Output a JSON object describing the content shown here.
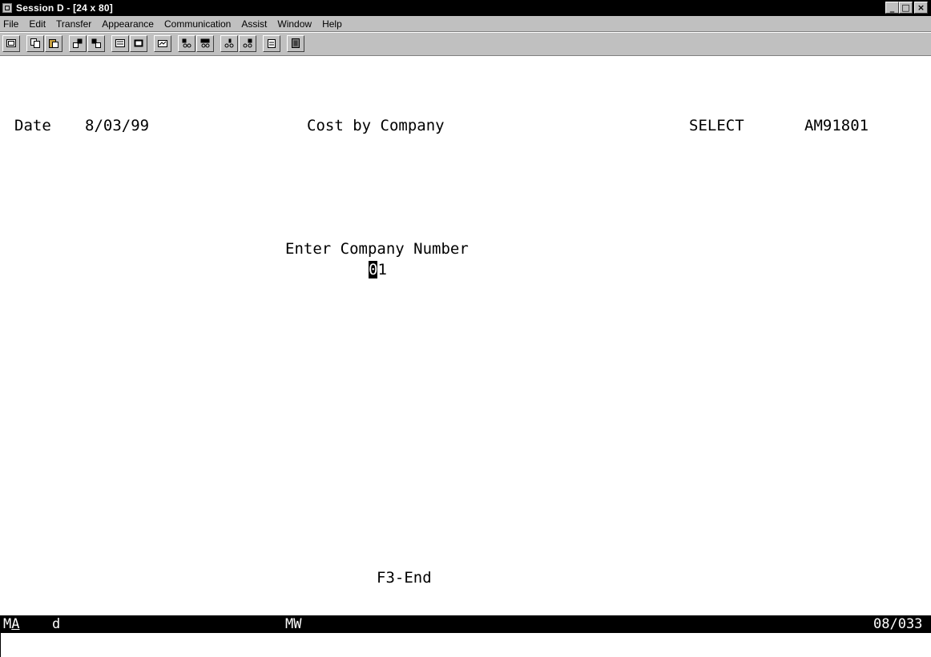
{
  "window": {
    "title": "Session D - [24 x 80]",
    "minimize": "_",
    "maximize": "□",
    "close": "×"
  },
  "menu": {
    "items": [
      "File",
      "Edit",
      "Transfer",
      "Appearance",
      "Communication",
      "Assist",
      "Window",
      "Help"
    ]
  },
  "toolbar": {
    "icons": [
      "print-screen-icon",
      "copy-icon",
      "paste-icon",
      "send-file-icon",
      "receive-file-icon",
      "keypad-icon",
      "display-icon",
      "macro-icon",
      "record-macro-icon",
      "play-macro-icon",
      "start-record-icon",
      "stop-record-icon",
      "clipboard-icon",
      "exit-icon"
    ]
  },
  "screen": {
    "date_label": "Date",
    "date_value": "8/03/99",
    "title": "Cost by Company",
    "mode": "SELECT",
    "program_id": "AM91801",
    "prompt": "Enter Company Number",
    "field_cursor_char": "0",
    "field_rest": "1",
    "function_keys": "F3-End"
  },
  "status": {
    "ma_first": "M",
    "ma_second": "A",
    "indicator": "d",
    "mw": "MW",
    "position": "08/033"
  }
}
